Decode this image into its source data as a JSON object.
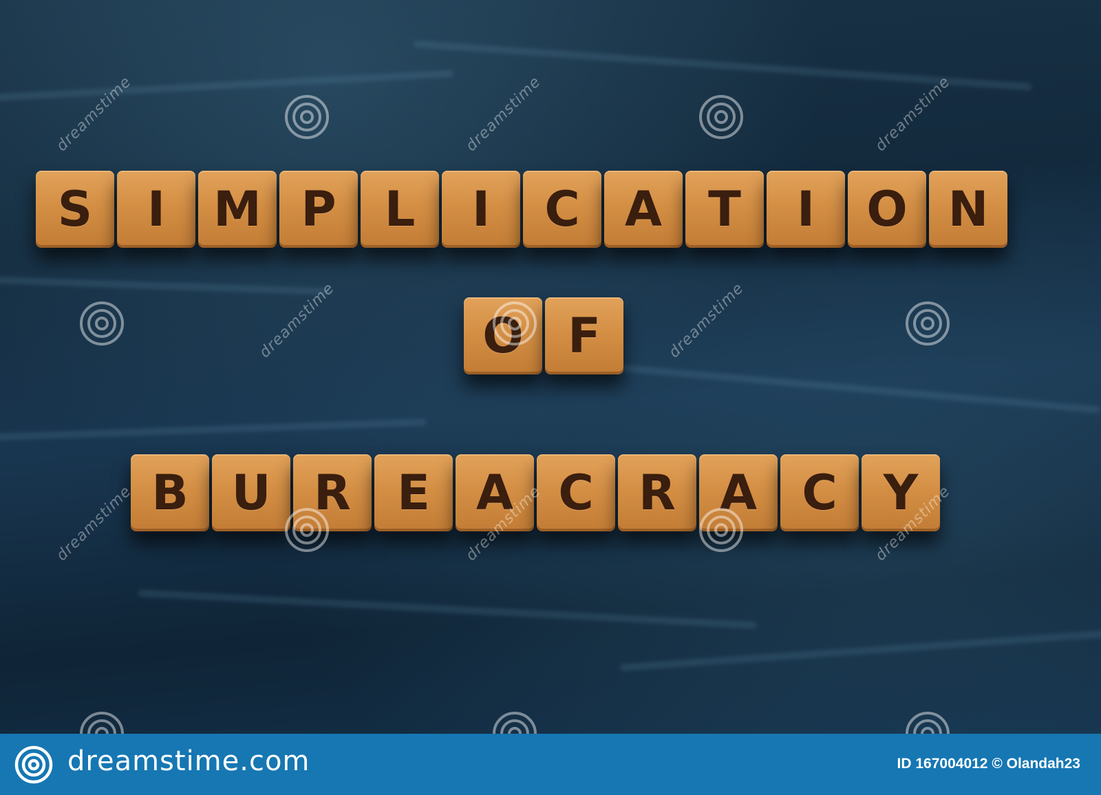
{
  "photo": {
    "subject": "letter-cubes",
    "words": {
      "line1": [
        "S",
        "I",
        "M",
        "P",
        "L",
        "I",
        "C",
        "A",
        "T",
        "I",
        "O",
        "N"
      ],
      "line2": [
        "O",
        "F"
      ],
      "line3": [
        "B",
        "U",
        "R",
        "E",
        "A",
        "C",
        "R",
        "A",
        "C",
        "Y"
      ]
    },
    "colors": {
      "background": "#15304a",
      "cube": "#d48f45",
      "letter": "#3a1e0e"
    }
  },
  "watermark": {
    "text": "dreamstime",
    "icon": "spiral-icon"
  },
  "footer": {
    "logo_icon": "spiral-icon",
    "site": "dreamstime.com",
    "credit": "ID 167004012 © Olandah23",
    "color": "#1677b3"
  }
}
